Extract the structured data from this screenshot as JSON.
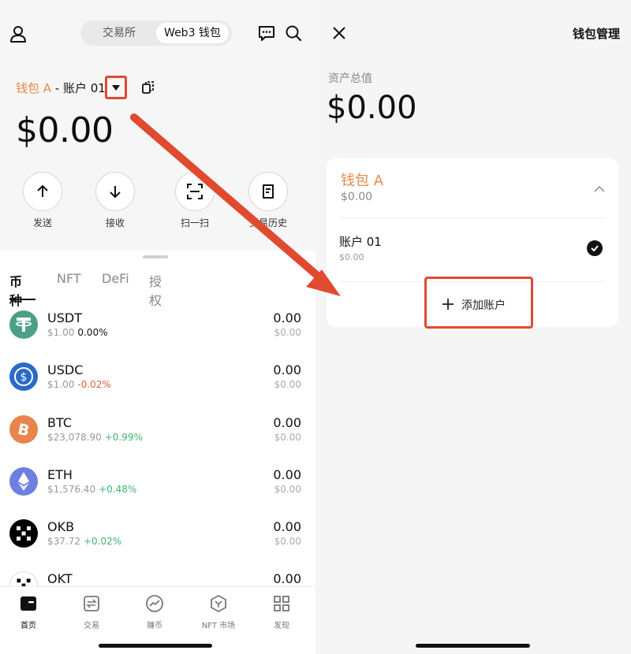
{
  "left_screen": {
    "header": {
      "tabs": [
        "交易所",
        "Web3 钱包"
      ],
      "active_tab": "Web3 钱包"
    },
    "wallet": {
      "wallet_name": "钱包 A",
      "separator": " - ",
      "account_name": "账户 01",
      "balance": "$0.00"
    },
    "actions": [
      {
        "label": "发送",
        "icon": "arrow-up-icon"
      },
      {
        "label": "接收",
        "icon": "arrow-down-icon"
      },
      {
        "label": "扫一扫",
        "icon": "scan-icon"
      },
      {
        "label": "交易历史",
        "icon": "history-icon"
      }
    ],
    "asset_tabs": [
      "币种",
      "NFT",
      "DeFi",
      "授权"
    ],
    "active_asset_tab": "币种",
    "assets": [
      {
        "symbol": "USDT",
        "price": "$1.00",
        "change": "0.00%",
        "amount": "0.00",
        "value": "$0.00",
        "color": "#4ba086"
      },
      {
        "symbol": "USDC",
        "price": "$1.00",
        "change": "-0.02%",
        "amount": "0.00",
        "value": "$0.00",
        "color": "#2a6ac8"
      },
      {
        "symbol": "BTC",
        "price": "$23,078.90",
        "change": "+0.99%",
        "amount": "0.00",
        "value": "$0.00",
        "color": "#e7854c"
      },
      {
        "symbol": "ETH",
        "price": "$1,576.40",
        "change": "+0.48%",
        "amount": "0.00",
        "value": "$0.00",
        "color": "#6d7fe0"
      },
      {
        "symbol": "OKB",
        "price": "$37.72",
        "change": "+0.02%",
        "amount": "0.00",
        "value": "$0.00",
        "color": "#000000"
      },
      {
        "symbol": "OKT",
        "price": "",
        "change": "",
        "amount": "0.00",
        "value": "",
        "color": "#000000"
      }
    ],
    "bottom_nav": [
      {
        "label": "首页",
        "icon": "wallet-icon"
      },
      {
        "label": "交易",
        "icon": "trade-icon"
      },
      {
        "label": "赚币",
        "icon": "earn-icon"
      },
      {
        "label": "NFT 市场",
        "icon": "nft-market-icon"
      },
      {
        "label": "发现",
        "icon": "discover-icon"
      }
    ],
    "active_nav": "首页"
  },
  "right_screen": {
    "title": "钱包管理",
    "total_label": "资产总值",
    "total_value": "$0.00",
    "wallet_card": {
      "wallet_name": "钱包 A",
      "wallet_balance": "$0.00",
      "account": {
        "name": "账户 01",
        "balance": "$0.00",
        "selected": true
      },
      "add_account_label": "添加账户"
    }
  },
  "colors": {
    "accent_orange": "#e78a4b",
    "annotation_red": "#e04a2f",
    "positive_green": "#3fb576",
    "negative_red": "#e0603c"
  }
}
